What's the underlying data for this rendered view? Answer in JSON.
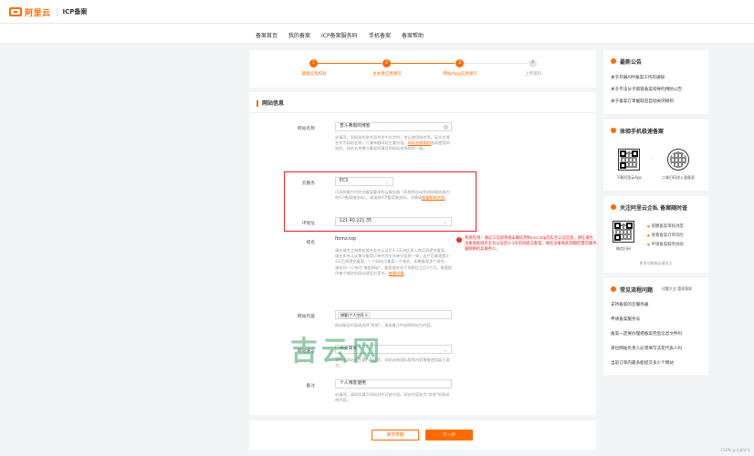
{
  "header": {
    "brand": "阿里云",
    "product": "ICP备案"
  },
  "nav": {
    "items": [
      "备案首页",
      "我的备案",
      "ICP备案服务码",
      "手机备案",
      "备案帮助"
    ]
  },
  "steps": [
    {
      "num": "1",
      "label": "基础信息校验"
    },
    {
      "num": "2",
      "label": "主办者信息填写"
    },
    {
      "num": "3",
      "label": "网站/App信息填写"
    },
    {
      "num": "4",
      "label": "上传资料"
    }
  ],
  "form": {
    "section_title": "网站信息",
    "site_name": {
      "label": "网站名称",
      "value": "普斗弗雨的博客",
      "hint_pre": "必填项。同网站的命名须符合中文字符，禁止使用域名等。英文名域名作为网站名称，只兼单顺网站主要内容。",
      "hint_link": "网站名称规则",
      "hint_post": "若网使用网站时，网站名称需与备案时填写的网站名称保持一致。"
    },
    "cloud_service": {
      "label": "云服务",
      "value": "ECS",
      "hint_pre": "可选择备付内符合备案要求的云服务器（系统将自动检测该服务器内的ICP备案服务码）。或请按ICP备案服务码，详情请",
      "hint_link": "查看帮助文档",
      "hint_post": "。"
    },
    "ip": {
      "label": "IP地址",
      "value": "121.40.221.35"
    },
    "domain": {
      "label": "域名",
      "value": "fbnnx.top",
      "hint_pre": "请在域名注册商处域名实名认证后3-3天内信息入库后再提交备案。域名实名认证需与备案订单中的主办单位信息一致，还产后需理提3-3天后再提交备案。一个网站可备案一个域名，如需备案多个域名，请在同一订单内\"增加网站\"。备案域名须于到期日之后3个月，需要提供每个域名的网站建设方案书。",
      "hint_link": "查看详情",
      "hint_post": "。",
      "error": "系统检测：通过工信部系统未确实到fbnnx.top的实名认证信息，请在域名注册商处域名实名认证后3-3天后再提交备案。域名注册商处到期后需云服务器网络机兵服务①。"
    },
    "content": {
      "label": "网站内容",
      "tag": "博客/个人空间",
      "tag_close": "×",
      "hint": "网站服务内容或选择\"其他\"。请选备注中说明网站内内容。"
    },
    "language": {
      "label": "网站语言",
      "value": "中文简体",
      "hint": "请勾选网站的主要内容语言，网站选有国际版等内容需备使用展于要言。"
    },
    "remark": {
      "label": "备注",
      "value": "个人博客使用",
      "hint": "必填项。请如实填写网站对外开放内容。网站内容若为\"其他\"时请说明内容。"
    }
  },
  "actions": {
    "save": "保存草稿",
    "next": "下一步"
  },
  "sidebar": {
    "announce": {
      "title": "最新公告",
      "links": [
        "关于开展APP备案工作的通知",
        "关于不法分子假冒备案指导的预防公告",
        "关于备案订单截取后自动关闭规则"
      ]
    },
    "mobile": {
      "title": "体验手机极速备案",
      "app_label": "下载阿里云App",
      "mini_label": "二维扫码进入速备案"
    },
    "follow": {
      "title": "关注阿里云企私 备案随时查",
      "qr_label": "微信扫码",
      "bullets": [
        "提醒备案审核进度",
        "查看备案订单风险",
        "申请备案服务协助"
      ],
      "more": "更多功能服务请关注"
    },
    "faq": {
      "title": "常见流程问题",
      "tag": "问题大全 管家帮助",
      "links": [
        "支持备案的云服务器",
        "申请备案服务号",
        "备案一定要办理把备案完后信息文件吗",
        "单位网站负责人必须填写法定代表人吗",
        "当前订单内最多能提交多少个网站"
      ]
    }
  },
  "watermark": "吉云网",
  "footnote": "CSDN @五星学号",
  "colors": {
    "accent": "#ff6a00",
    "error": "#e22222"
  }
}
